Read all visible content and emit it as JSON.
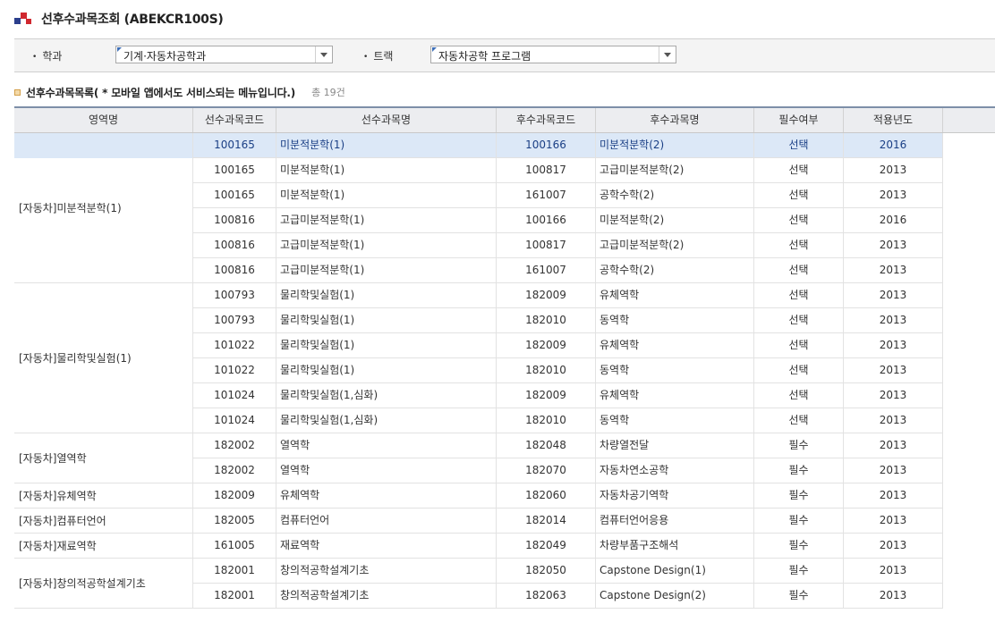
{
  "page": {
    "title": "선후수과목조회 (ABEKCR100S)"
  },
  "search": {
    "dept_label": "학과",
    "dept_value": "기계·자동차공학과",
    "track_label": "트랙",
    "track_value": "자동차공학 프로그램"
  },
  "section": {
    "title": "선후수과목목록( * 모바일 앱에서도 서비스되는 메뉴입니다.)",
    "count": "총 19건"
  },
  "colors": {
    "selected_row": "#dce8f7",
    "header_bg": "#ecedf0",
    "brand_red": "#d0282f",
    "brand_blue": "#2b3f8c"
  },
  "grid": {
    "columns": [
      "영역명",
      "선수과목코드",
      "선수과목명",
      "후수과목코드",
      "후수과목명",
      "필수여부",
      "적용년도"
    ],
    "groups": [
      {
        "name": "[자동차]미분적분학(1)",
        "start": 0,
        "span": 6
      },
      {
        "name": "[자동차]물리학및실험(1)",
        "start": 6,
        "span": 6
      },
      {
        "name": "[자동차]열역학",
        "start": 12,
        "span": 2
      },
      {
        "name": "[자동차]유체역학",
        "start": 14,
        "span": 1
      },
      {
        "name": "[자동차]컴퓨터언어",
        "start": 15,
        "span": 1
      },
      {
        "name": "[자동차]재료역학",
        "start": 16,
        "span": 1
      },
      {
        "name": "[자동차]창의적공학설계기초",
        "start": 17,
        "span": 2
      }
    ],
    "rows": [
      {
        "pre_code": "100165",
        "pre_name": "미분적분학(1)",
        "post_code": "100166",
        "post_name": "미분적분학(2)",
        "required": "선택",
        "year": "2016"
      },
      {
        "pre_code": "100165",
        "pre_name": "미분적분학(1)",
        "post_code": "100817",
        "post_name": "고급미분적분학(2)",
        "required": "선택",
        "year": "2013"
      },
      {
        "pre_code": "100165",
        "pre_name": "미분적분학(1)",
        "post_code": "161007",
        "post_name": "공학수학(2)",
        "required": "선택",
        "year": "2013"
      },
      {
        "pre_code": "100816",
        "pre_name": "고급미분적분학(1)",
        "post_code": "100166",
        "post_name": "미분적분학(2)",
        "required": "선택",
        "year": "2016"
      },
      {
        "pre_code": "100816",
        "pre_name": "고급미분적분학(1)",
        "post_code": "100817",
        "post_name": "고급미분적분학(2)",
        "required": "선택",
        "year": "2013"
      },
      {
        "pre_code": "100816",
        "pre_name": "고급미분적분학(1)",
        "post_code": "161007",
        "post_name": "공학수학(2)",
        "required": "선택",
        "year": "2013"
      },
      {
        "pre_code": "100793",
        "pre_name": "물리학및실험(1)",
        "post_code": "182009",
        "post_name": "유체역학",
        "required": "선택",
        "year": "2013"
      },
      {
        "pre_code": "100793",
        "pre_name": "물리학및실험(1)",
        "post_code": "182010",
        "post_name": "동역학",
        "required": "선택",
        "year": "2013"
      },
      {
        "pre_code": "101022",
        "pre_name": "물리학및실험(1)",
        "post_code": "182009",
        "post_name": "유체역학",
        "required": "선택",
        "year": "2013"
      },
      {
        "pre_code": "101022",
        "pre_name": "물리학및실험(1)",
        "post_code": "182010",
        "post_name": "동역학",
        "required": "선택",
        "year": "2013"
      },
      {
        "pre_code": "101024",
        "pre_name": "물리학및실험(1,심화)",
        "post_code": "182009",
        "post_name": "유체역학",
        "required": "선택",
        "year": "2013"
      },
      {
        "pre_code": "101024",
        "pre_name": "물리학및실험(1,심화)",
        "post_code": "182010",
        "post_name": "동역학",
        "required": "선택",
        "year": "2013"
      },
      {
        "pre_code": "182002",
        "pre_name": "열역학",
        "post_code": "182048",
        "post_name": "차량열전달",
        "required": "필수",
        "year": "2013"
      },
      {
        "pre_code": "182002",
        "pre_name": "열역학",
        "post_code": "182070",
        "post_name": "자동차연소공학",
        "required": "필수",
        "year": "2013"
      },
      {
        "pre_code": "182009",
        "pre_name": "유체역학",
        "post_code": "182060",
        "post_name": "자동차공기역학",
        "required": "필수",
        "year": "2013"
      },
      {
        "pre_code": "182005",
        "pre_name": "컴퓨터언어",
        "post_code": "182014",
        "post_name": "컴퓨터언어응용",
        "required": "필수",
        "year": "2013"
      },
      {
        "pre_code": "161005",
        "pre_name": "재료역학",
        "post_code": "182049",
        "post_name": "차량부품구조해석",
        "required": "필수",
        "year": "2013"
      },
      {
        "pre_code": "182001",
        "pre_name": "창의적공학설계기초",
        "post_code": "182050",
        "post_name": "Capstone Design(1)",
        "required": "필수",
        "year": "2013"
      },
      {
        "pre_code": "182001",
        "pre_name": "창의적공학설계기초",
        "post_code": "182063",
        "post_name": "Capstone Design(2)",
        "required": "필수",
        "year": "2013"
      }
    ],
    "selected_row": 0
  }
}
